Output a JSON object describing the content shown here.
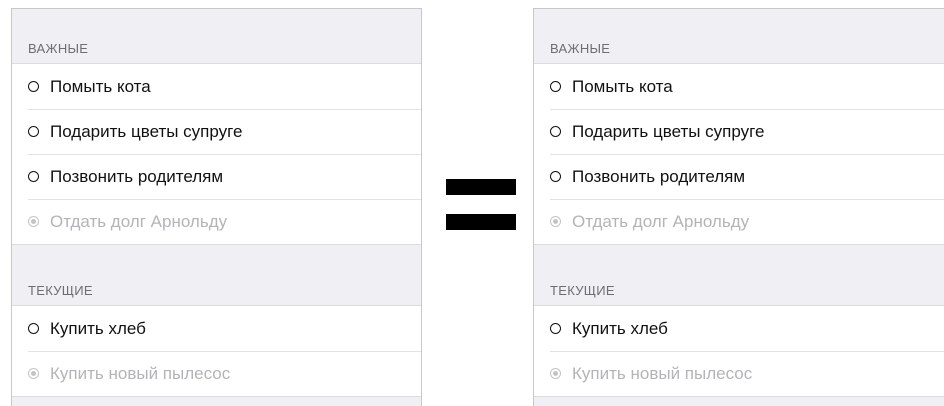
{
  "panels": [
    {
      "sections": [
        {
          "header": "ВАЖНЫЕ",
          "items": [
            {
              "label": "Помыть кота",
              "done": false
            },
            {
              "label": "Подарить цветы супруге",
              "done": false
            },
            {
              "label": "Позвонить родителям",
              "done": false
            },
            {
              "label": "Отдать долг Арнольду",
              "done": true
            }
          ]
        },
        {
          "header": "ТЕКУЩИЕ",
          "items": [
            {
              "label": "Купить хлеб",
              "done": false
            },
            {
              "label": "Купить новый пылесос",
              "done": true
            }
          ]
        }
      ]
    },
    {
      "sections": [
        {
          "header": "ВАЖНЫЕ",
          "items": [
            {
              "label": "Помыть кота",
              "done": false
            },
            {
              "label": "Подарить цветы супруге",
              "done": false
            },
            {
              "label": "Позвонить родителям",
              "done": false
            },
            {
              "label": "Отдать долг Арнольду",
              "done": true
            }
          ]
        },
        {
          "header": "ТЕКУЩИЕ",
          "items": [
            {
              "label": "Купить хлеб",
              "done": false
            },
            {
              "label": "Купить новый пылесос",
              "done": true
            }
          ]
        }
      ]
    }
  ]
}
